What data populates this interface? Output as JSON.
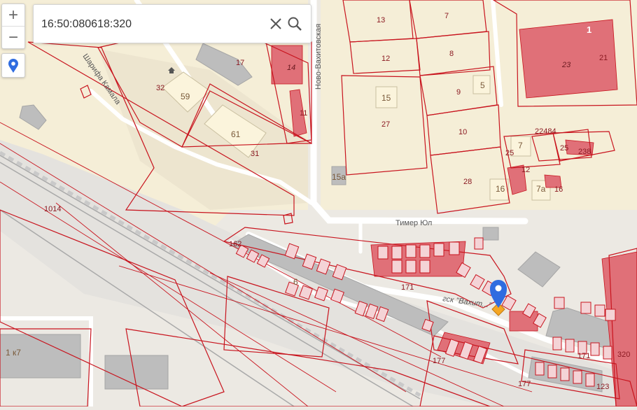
{
  "search": {
    "value": "16:50:080618:320",
    "placeholder": ""
  },
  "controls": {
    "zoom_in": "+",
    "zoom_out": "−"
  },
  "icons": {
    "zoom_in": "plus-icon",
    "zoom_out": "minus-icon",
    "location": "map-pin-icon",
    "clear": "close-icon",
    "search": "search-icon",
    "marker": "location-marker-icon",
    "building": "building-icon"
  },
  "streets": {
    "novo_vakhitovskaya": "Ново-Вахитовская",
    "sharifa_kamala": "Шарифа Камала",
    "timer_yul": "Тимер Юл",
    "gsk": "гск \"Вахит...\""
  },
  "labels": {
    "b13": "13",
    "b7": "7",
    "b8": "8",
    "b12": "12",
    "b9": "9",
    "b5": "5",
    "b15": "15",
    "b27": "27",
    "b10": "10",
    "b28": "28",
    "b16": "16",
    "b7a": "7а",
    "b15a": "15а",
    "b1": "1",
    "b23": "23",
    "b21": "21",
    "b22484": "22484",
    "b25": "25",
    "b238": "238",
    "b7r": "7",
    "b25v": "25",
    "b12v": "12",
    "b16r": "16",
    "b17": "17",
    "b14": "14",
    "b11": "11",
    "b32": "32",
    "b59": "59",
    "b61": "61",
    "b31": "31",
    "b1014": "1014",
    "b162": "162",
    "b6": "6",
    "b171": "171",
    "b177": "177",
    "b177b": "177",
    "b171b": "171",
    "b123": "123",
    "b320": "320",
    "b1k7": "1 к7"
  },
  "colors": {
    "parcel_outline": "#c8141e",
    "building_red": "#e07078",
    "building_beige": "#fbf4dc",
    "building_gray": "#b9b9b9",
    "residential": "#f5eed7",
    "marker": "#2f6ce0",
    "marker_accent": "#f5a623"
  }
}
